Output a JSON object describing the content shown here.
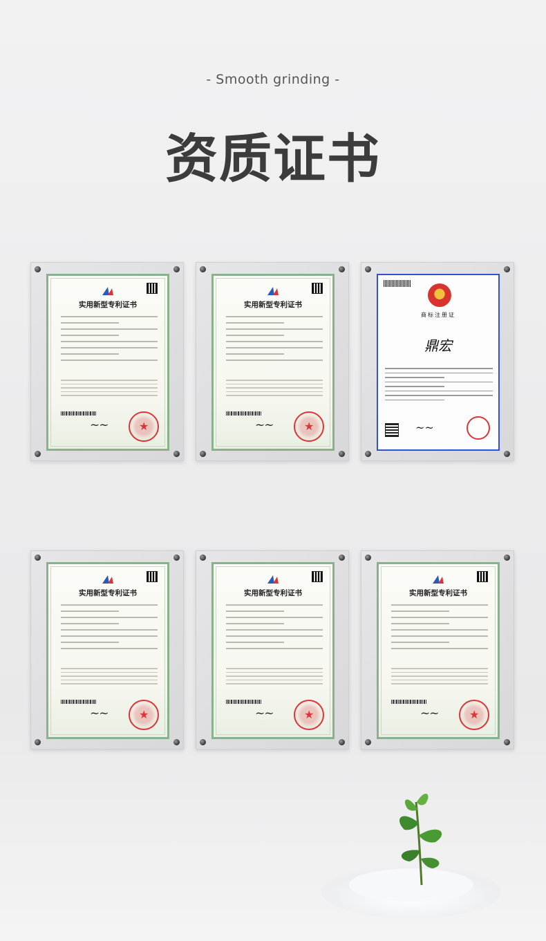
{
  "header": {
    "subtitle": "- Smooth grinding -",
    "title": "资质证书"
  },
  "certificates": [
    {
      "kind": "patent",
      "title": "实用新型专利证书"
    },
    {
      "kind": "patent",
      "title": "实用新型专利证书"
    },
    {
      "kind": "trademark",
      "title": "商标注册证",
      "mark": "鼎宏"
    },
    {
      "kind": "patent",
      "title": "实用新型专利证书"
    },
    {
      "kind": "patent",
      "title": "实用新型专利证书"
    },
    {
      "kind": "patent",
      "title": "实用新型专利证书"
    }
  ],
  "colors": {
    "patent_border": "#8bb08e",
    "trademark_border": "#3050d8",
    "seal_red": "#d8363a",
    "title_text": "#3c3c3c"
  }
}
